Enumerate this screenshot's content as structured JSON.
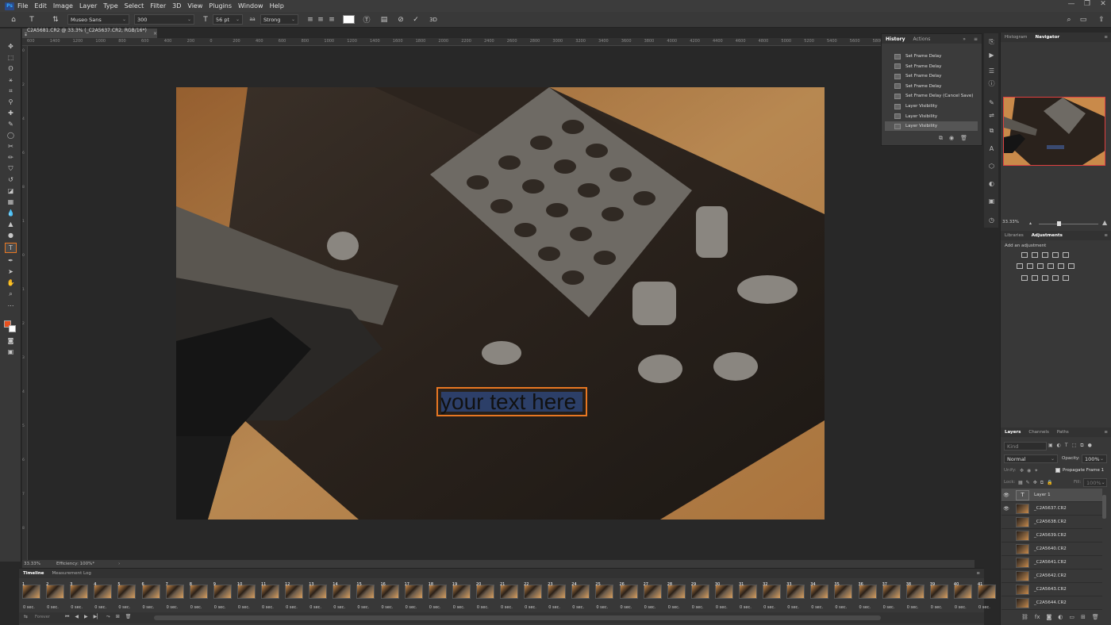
{
  "menu": {
    "logo": "Ps",
    "items": [
      "File",
      "Edit",
      "Image",
      "Layer",
      "Type",
      "Select",
      "Filter",
      "3D",
      "View",
      "Plugins",
      "Window",
      "Help"
    ],
    "window_buttons": [
      "—",
      "❐",
      "✕"
    ]
  },
  "options": {
    "font_family": "Museo Sans",
    "font_style": "300",
    "font_size": "56 pt",
    "antialias_label": "aa",
    "antialias": "Strong",
    "color_swatch": "#ffffff",
    "threed_label": "3D"
  },
  "document": {
    "tab_title": "_C2A5681.CR2 @ 33.3% (_C2A5637.CR2, RGB/16*) *",
    "ruler_h": [
      "600",
      "1400",
      "1200",
      "1000",
      "800",
      "600",
      "400",
      "200",
      "0",
      "200",
      "400",
      "600",
      "800",
      "1000",
      "1200",
      "1400",
      "1600",
      "1800",
      "2000",
      "2200",
      "2400",
      "2600",
      "2800",
      "3000",
      "3200",
      "3400",
      "3600",
      "3800",
      "4000",
      "4200",
      "4400",
      "4600",
      "4800",
      "5000",
      "5200",
      "5400",
      "5600",
      "5800",
      "6000",
      "6200",
      "6400",
      "6600",
      "6800"
    ],
    "ruler_v": [
      "0",
      "2",
      "4",
      "6",
      "8",
      "1",
      "0",
      "1",
      "2",
      "3",
      "4",
      "5",
      "6",
      "7",
      "8"
    ],
    "canvas_text": "your text here"
  },
  "status": {
    "zoom": "33.33%",
    "info": "Efficiency: 100%*"
  },
  "history": {
    "tabs": [
      "History",
      "Actions"
    ],
    "items": [
      "Set Frame Delay",
      "Set Frame Delay",
      "Set Frame Delay",
      "Set Frame Delay",
      "Set Frame Delay (Cancel Save)",
      "Layer Visibility",
      "Layer Visibility",
      "Layer Visibility"
    ]
  },
  "navigator": {
    "tabs": [
      "Histogram",
      "Navigator"
    ],
    "zoom": "33.33%"
  },
  "adjustments": {
    "tabs": [
      "Libraries",
      "Adjustments"
    ],
    "hint": "Add an adjustment"
  },
  "layers": {
    "tabs": [
      "Layers",
      "Channels",
      "Paths"
    ],
    "search_placeholder": "Kind",
    "blend_mode": "Normal",
    "opacity_label": "Opacity:",
    "opacity": "100%",
    "unify_label": "Unify:",
    "propagate": "Propagate Frame 1",
    "lock_label": "Lock:",
    "fill_label": "Fill:",
    "fill": "100%",
    "items": [
      {
        "name": "Layer 1",
        "type": "text",
        "visible": true
      },
      {
        "name": "_C2A5637.CR2",
        "type": "image",
        "visible": true
      },
      {
        "name": "_C2A5638.CR2",
        "type": "image",
        "visible": false
      },
      {
        "name": "_C2A5639.CR2",
        "type": "image",
        "visible": false
      },
      {
        "name": "_C2A5640.CR2",
        "type": "image",
        "visible": false
      },
      {
        "name": "_C2A5641.CR2",
        "type": "image",
        "visible": false
      },
      {
        "name": "_C2A5642.CR2",
        "type": "image",
        "visible": false
      },
      {
        "name": "_C2A5643.CR2",
        "type": "image",
        "visible": false
      },
      {
        "name": "_C2A5644.CR2",
        "type": "image",
        "visible": false
      }
    ]
  },
  "timeline": {
    "tabs": [
      "Timeline",
      "Measurement Log"
    ],
    "frame_delay": "0 sec.",
    "loop": "Forever",
    "frames": [
      "1",
      "2",
      "3",
      "4",
      "5",
      "6",
      "7",
      "8",
      "9",
      "10",
      "11",
      "12",
      "13",
      "14",
      "15",
      "16",
      "17",
      "18",
      "19",
      "20",
      "21",
      "22",
      "23",
      "24",
      "25",
      "26",
      "27",
      "28",
      "29",
      "30",
      "31",
      "32",
      "33",
      "34",
      "35",
      "36",
      "37",
      "38",
      "39",
      "40",
      "41"
    ]
  }
}
